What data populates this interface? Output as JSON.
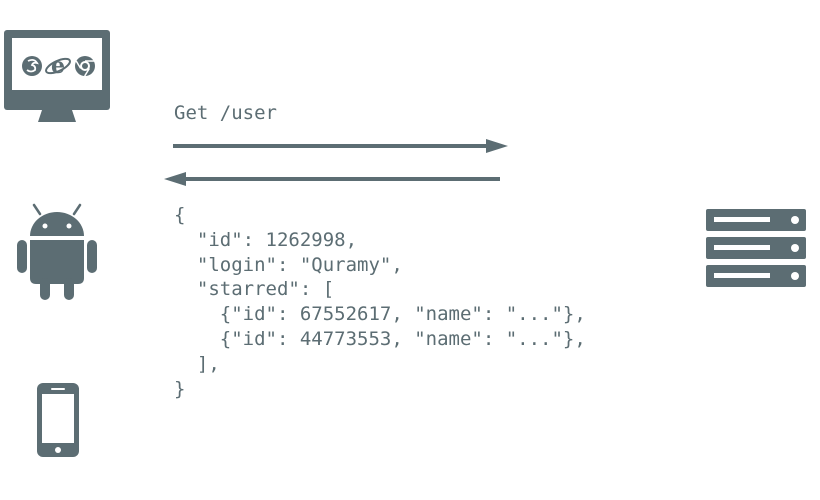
{
  "request": {
    "label": "Get /user"
  },
  "response": {
    "lines": [
      "{",
      "  \"id\": 1262998,",
      "  \"login\": \"Quramy\",",
      "  \"starred\": [",
      "    {\"id\": 67552617, \"name\": \"...\"},",
      "    {\"id\": 44773553, \"name\": \"...\"},",
      "  ],",
      "}"
    ]
  },
  "icons": {
    "desktop": "desktop-browser-icon",
    "android": "android-icon",
    "phone": "smartphone-icon",
    "server": "server-icon"
  },
  "colors": {
    "primary": "#5c6d73",
    "background": "#ffffff"
  }
}
